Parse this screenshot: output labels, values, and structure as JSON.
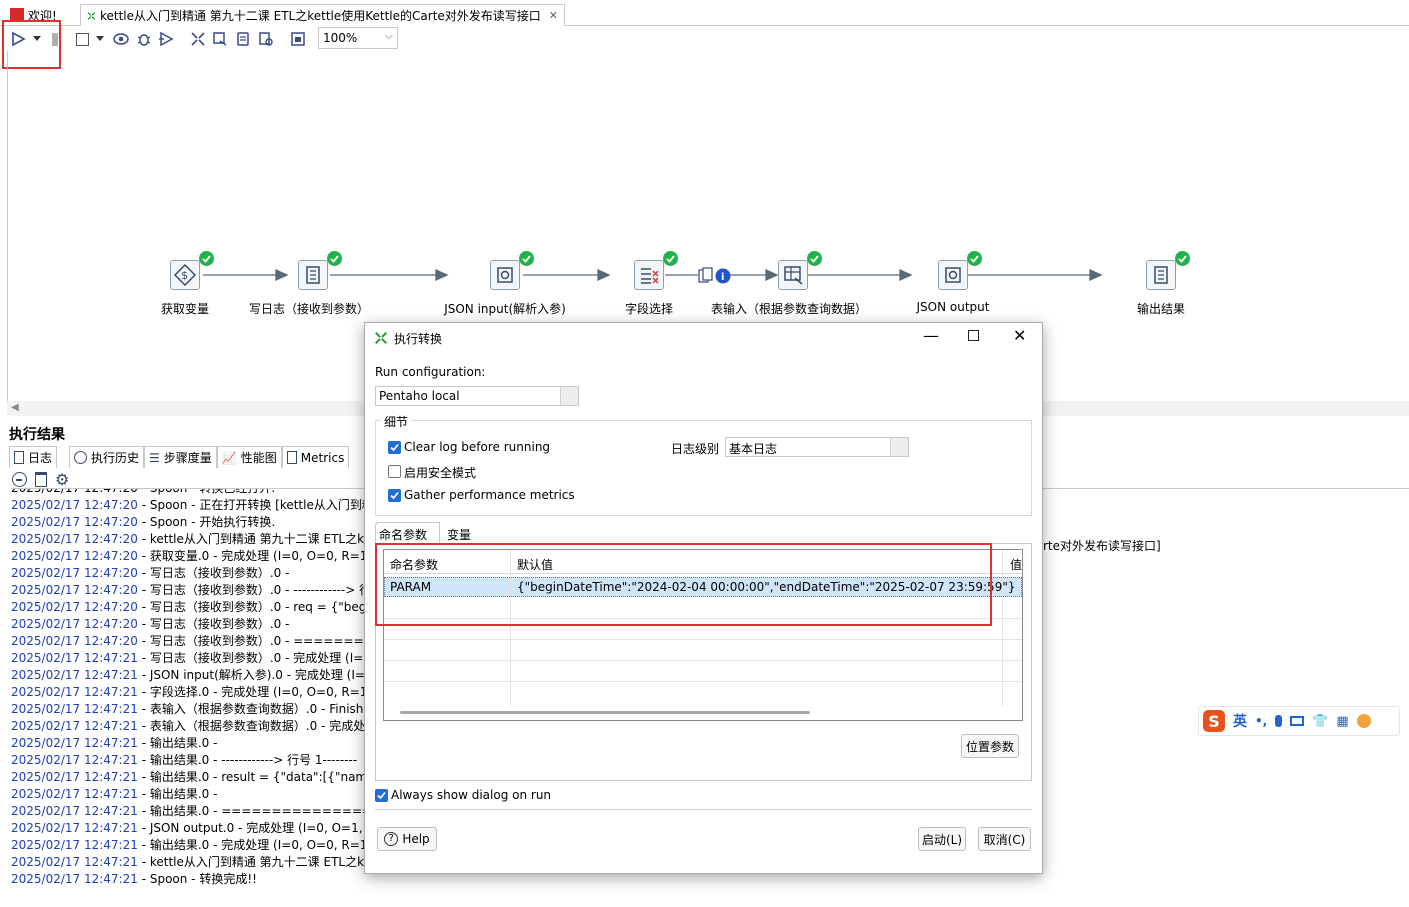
{
  "tabs": {
    "welcome": "欢迎!",
    "transformation": "kettle从入门到精通 第九十二课 ETL之kettle使用Kettle的Carte对外发布读写接口"
  },
  "toolbar": {
    "zoom": "100%"
  },
  "steps": [
    {
      "label": "获取变量"
    },
    {
      "label": "写日志（接收到参数）"
    },
    {
      "label": "JSON input(解析入参)"
    },
    {
      "label": "字段选择"
    },
    {
      "label": "表输入（根据参数查询数据）"
    },
    {
      "label": "JSON output"
    },
    {
      "label": "输出结果"
    }
  ],
  "results": {
    "title": "执行结果",
    "tabs": [
      "日志",
      "执行历史",
      "步骤度量",
      "性能图",
      "Metrics"
    ],
    "log_partial_top": "2025/02/17 12:47:20 - Spoon - 转换已经打开.",
    "log_right_fragment": "rte对外发布读写接口]",
    "log": [
      {
        "ts": "2025/02/17 12:47:20",
        "msg": " - Spoon - 正在打开转换 [kettle从入门到精"
      },
      {
        "ts": "2025/02/17 12:47:20",
        "msg": " - Spoon - 开始执行转换."
      },
      {
        "ts": "2025/02/17 12:47:20",
        "msg": " - kettle从入门到精通 第九十二课 ETL之ket"
      },
      {
        "ts": "2025/02/17 12:47:20",
        "msg": " - 获取变量.0 - 完成处理 (I=0, O=0, R=1, V"
      },
      {
        "ts": "2025/02/17 12:47:20",
        "msg": " - 写日志（接收到参数）.0 -"
      },
      {
        "ts": "2025/02/17 12:47:20",
        "msg": " - 写日志（接收到参数）.0 - ------------> 行"
      },
      {
        "ts": "2025/02/17 12:47:20",
        "msg": " - 写日志（接收到参数）.0 - req = {\"begin"
      },
      {
        "ts": "2025/02/17 12:47:20",
        "msg": " - 写日志（接收到参数）.0 -"
      },
      {
        "ts": "2025/02/17 12:47:20",
        "msg": " - 写日志（接收到参数）.0 - ==========="
      },
      {
        "ts": "2025/02/17 12:47:21",
        "msg": " - 写日志（接收到参数）.0 - 完成处理 (I=0,"
      },
      {
        "ts": "2025/02/17 12:47:21",
        "msg": " - JSON input(解析入参).0 - 完成处理 (I=1,"
      },
      {
        "ts": "2025/02/17 12:47:21",
        "msg": " - 字段选择.0 - 完成处理 (I=0, O=0, R=1, V"
      },
      {
        "ts": "2025/02/17 12:47:21",
        "msg": " - 表输入（根据参数查询数据）.0 - Finished"
      },
      {
        "ts": "2025/02/17 12:47:21",
        "msg": " - 表输入（根据参数查询数据）.0 - 完成处理"
      },
      {
        "ts": "2025/02/17 12:47:21",
        "msg": " - 输出结果.0 -"
      },
      {
        "ts": "2025/02/17 12:47:21",
        "msg": " - 输出结果.0 - ------------> 行号 1--------"
      },
      {
        "ts": "2025/02/17 12:47:21",
        "msg": " - 输出结果.0 - result = {\"data\":[{\"name\":"
      },
      {
        "ts": "2025/02/17 12:47:21",
        "msg": " - 输出结果.0 -"
      },
      {
        "ts": "2025/02/17 12:47:21",
        "msg": " - 输出结果.0 - ===================="
      },
      {
        "ts": "2025/02/17 12:47:21",
        "msg": " - JSON output.0 - 完成处理 (I=0, O=1, R"
      },
      {
        "ts": "2025/02/17 12:47:21",
        "msg": " - 输出结果.0 - 完成处理 (I=0, O=0, R=1, V"
      },
      {
        "ts": "2025/02/17 12:47:21",
        "msg": " - kettle从入门到精通 第九十二课 ETL之ket"
      },
      {
        "ts": "2025/02/17 12:47:21",
        "msg": " - Spoon - 转换完成!!"
      }
    ]
  },
  "dialog": {
    "title": "执行转换",
    "run_config_label": "Run configuration:",
    "run_config_value": "Pentaho local",
    "details_group": "细节",
    "clear_log": "Clear log before running",
    "safe_mode": "启用安全模式",
    "gather_metrics": "Gather performance metrics",
    "log_level_label": "日志级别",
    "log_level_value": "基本日志",
    "tab_params": "命名参数",
    "tab_vars": "变量",
    "grid_headers": [
      "命名参数",
      "默认值",
      "值"
    ],
    "grid_row": {
      "name": "PARAM",
      "default": "{\"beginDateTime\":\"2024-02-04 00:00:00\",\"endDateTime\":\"2025-02-07 23:59:59\"}"
    },
    "position_params_button": "位置参数",
    "always_show": "Always show dialog on run",
    "help_button": "Help",
    "start_button": "启动(L)",
    "cancel_button": "取消(C)"
  },
  "ime": {
    "lang": "英"
  }
}
